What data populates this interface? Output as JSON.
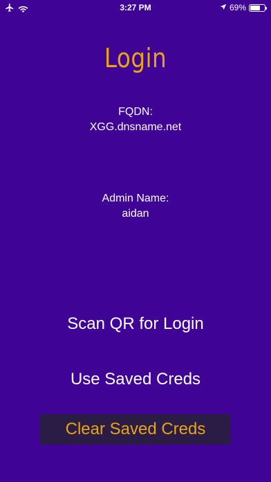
{
  "status_bar": {
    "time": "3:27 PM",
    "battery_percent": "69%",
    "battery_level": 0.69,
    "icons": [
      "airplane-icon",
      "wifi-icon",
      "location-arrow-icon",
      "battery-icon"
    ]
  },
  "screen": {
    "title": "Login",
    "fqdn_label": "FQDN:",
    "fqdn_value": "XGG.dnsname.net",
    "admin_label": "Admin Name:",
    "admin_value": "aidan"
  },
  "actions": {
    "scan_label": "Scan QR for Login",
    "saved_label": "Use Saved Creds",
    "clear_label": "Clear Saved Creds"
  },
  "colors": {
    "background": "#3f0396",
    "accent": "#e8a416",
    "clear_button_bg": "#2a1c44",
    "text": "#ffffff"
  }
}
